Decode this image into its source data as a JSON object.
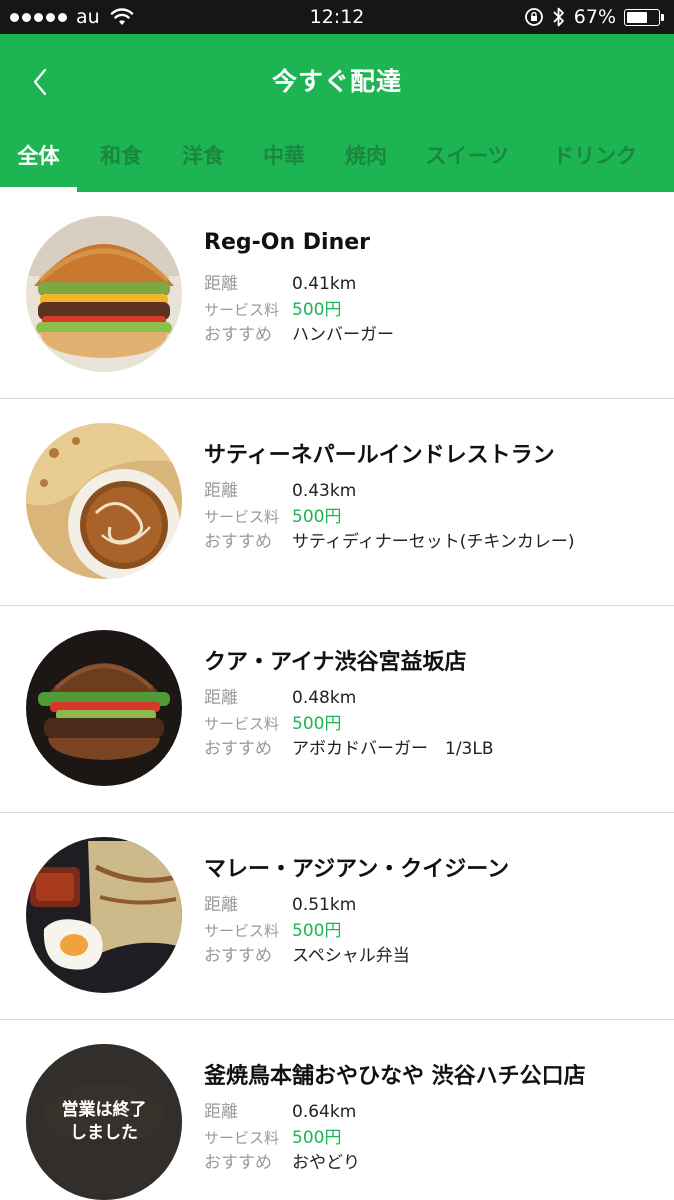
{
  "status_bar": {
    "carrier": "au",
    "time": "12:12",
    "battery_percent_text": "67%",
    "battery_level": 0.67
  },
  "header": {
    "title": "今すぐ配達"
  },
  "tabs": [
    {
      "label": "全体",
      "active": true
    },
    {
      "label": "和食",
      "active": false
    },
    {
      "label": "洋食",
      "active": false
    },
    {
      "label": "中華",
      "active": false
    },
    {
      "label": "焼肉",
      "active": false
    },
    {
      "label": "スイーツ",
      "active": false
    },
    {
      "label": "ドリンク",
      "active": false
    }
  ],
  "labels": {
    "distance": "距離",
    "fee": "サービス料",
    "recommend": "おすすめ"
  },
  "restaurants": [
    {
      "name": "Reg-On Diner",
      "distance": "0.41km",
      "fee": "500円",
      "recommend": "ハンバーガー",
      "thumb": "burger-avocado"
    },
    {
      "name": "サティーネパールインドレストラン",
      "distance": "0.43km",
      "fee": "500円",
      "recommend": "サティディナーセット(チキンカレー)",
      "thumb": "curry-naan"
    },
    {
      "name": "クア・アイナ渋谷宮益坂店",
      "distance": "0.48km",
      "fee": "500円",
      "recommend": "アボカドバーガー　1/3LB",
      "thumb": "burger-dark"
    },
    {
      "name": "マレー・アジアン・クイジーン",
      "distance": "0.51km",
      "fee": "500円",
      "recommend": "スペシャル弁当",
      "thumb": "bento"
    },
    {
      "name": "釜焼鳥本舗おやひなや 渋谷ハチ公口店",
      "distance": "0.64km",
      "fee": "500円",
      "recommend": "おやどり",
      "thumb": "yakitori",
      "closed_text": "営業は終了しました"
    }
  ],
  "colors": {
    "brand_green": "#1db553",
    "tab_inactive": "#1a8640",
    "status_bar": "#161616"
  }
}
